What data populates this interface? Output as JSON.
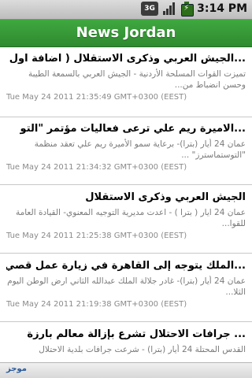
{
  "status_bar": {
    "network_label": "3G",
    "time": "3:14 PM",
    "icons": [
      "3g-icon",
      "signal-icon",
      "battery-charging-icon"
    ]
  },
  "header": {
    "title": "News Jordan",
    "color": "#379937"
  },
  "news_items": [
    {
      "title": "...الجيش العربي وذكرى الاستقلال ( اضافة اول",
      "summary": "تميزت القوات المسلحة الأردنية - الجيش العربي بالسمعة الطيبة وحسن انضباط من...",
      "date": "Tue May 24 2011 21:35:49 GMT+0300 (EEST)"
    },
    {
      "title": "...الاميرة ريم علي ترعى فعاليات مؤتمر \"التو",
      "summary": "عمان 24 أيار (بترا)- برعاية سمو الأميرة ريم علي تعقد منظمة \"التوستماسترز\" ...",
      "date": "Tue May 24 2011 21:34:32 GMT+0300 (EEST)"
    },
    {
      "title": "الجيش العربي وذكرى الاستقلال",
      "summary": "عمان 24 ايار ( بترا ) - اعدت مديرية التوجيه المعنوي- القيادة العامة للقوا...",
      "date": "Tue May 24 2011 21:25:38 GMT+0300 (EEST)"
    },
    {
      "title": "...الملك يتوجه إلى القاهرة في زيارة عمل قصي",
      "summary": "عمان 24 أيار (بترا)- غادر جلالة الملك عبدالله الثاني ارض الوطن اليوم الثلا...",
      "date": "Tue May 24 2011 21:19:38 GMT+0300 (EEST)"
    },
    {
      "title": "... جرافات الاحتلال تشرع بإزالة معالم بارزة",
      "summary": "القدس المحتلة 24 أيار (بترا) - شرعت جرافات بلدية الاحتلال",
      "date": ""
    }
  ],
  "bottom_bar": {
    "label": "موجز"
  }
}
